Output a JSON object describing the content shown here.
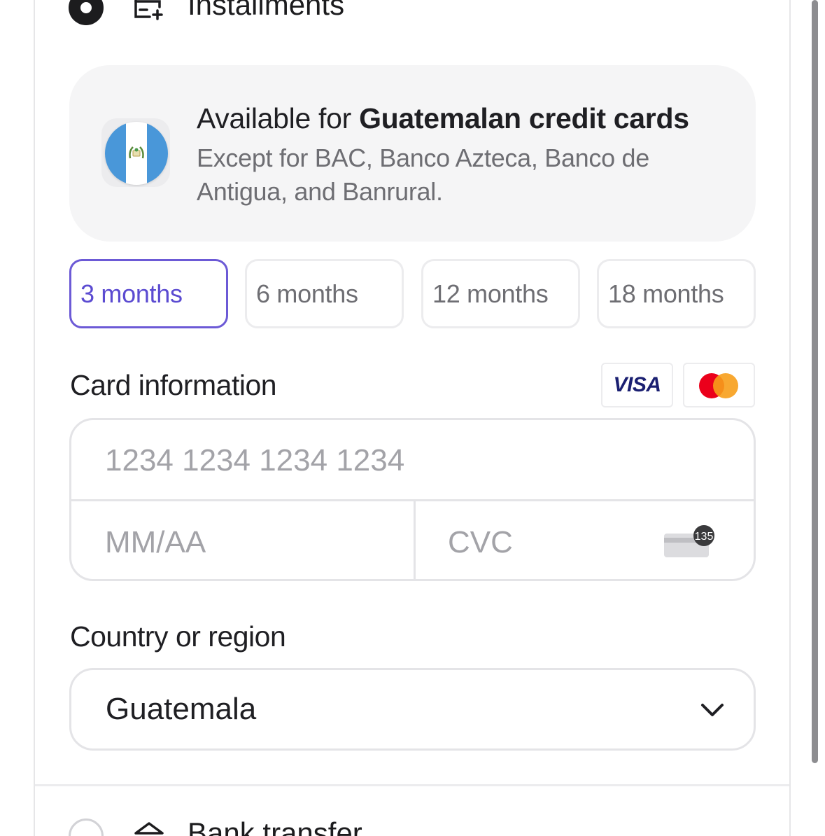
{
  "payment_methods": {
    "installments": {
      "label": "Installments",
      "selected": true
    },
    "bank_transfer": {
      "label": "Bank transfer",
      "selected": false
    }
  },
  "info": {
    "title_prefix": "Available for ",
    "title_bold": "Guatemalan credit cards",
    "subtitle": "Except for BAC, Banco Azteca, Banco de Antigua, and Banrural.",
    "flag_icon": "guatemala-flag-icon"
  },
  "terms": {
    "selected_index": 0,
    "options": [
      "3 months",
      "6 months",
      "12 months",
      "18 months"
    ]
  },
  "card": {
    "label": "Card information",
    "brands": [
      "VISA",
      "Mastercard"
    ],
    "number_placeholder": "1234 1234 1234 1234",
    "expiry_placeholder": "MM/AA",
    "cvc_placeholder": "CVC",
    "cvc_badge": "135"
  },
  "country": {
    "label": "Country or region",
    "value": "Guatemala"
  },
  "colors": {
    "accent": "#6c5ad6",
    "visa": "#1a1f71",
    "mc_red": "#eb001b",
    "mc_orange": "#f79e1b"
  }
}
